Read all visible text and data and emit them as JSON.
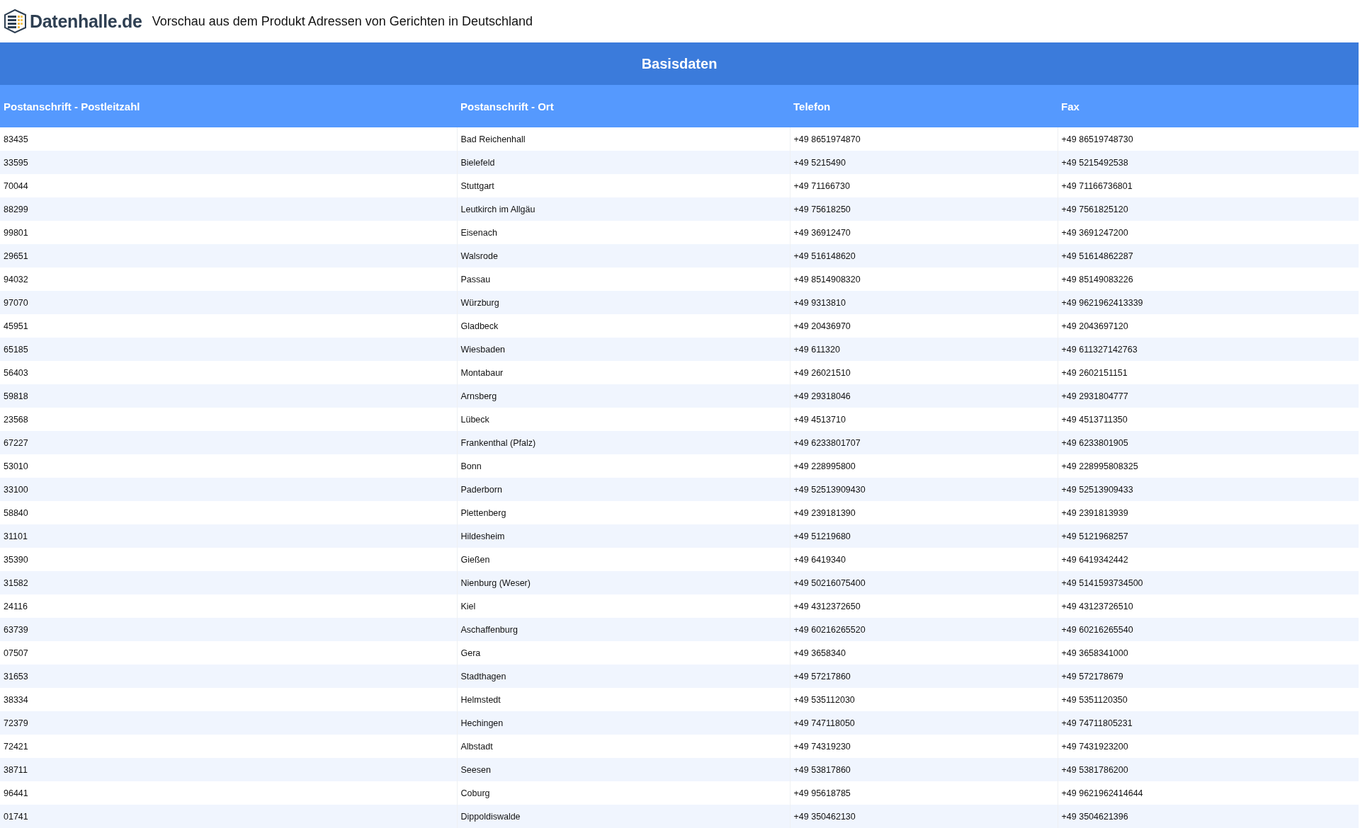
{
  "header": {
    "logo_text": "Datenhalle.de",
    "title": "Vorschau aus dem Produkt Adressen von Gerichten in Deutschland"
  },
  "table": {
    "group_title": "Basisdaten",
    "columns": [
      "Postanschrift - Postleitzahl",
      "Postanschrift - Ort",
      "Telefon",
      "Fax"
    ],
    "rows": [
      [
        "83435",
        "Bad Reichenhall",
        "+49 8651974870",
        "+49 86519748730"
      ],
      [
        "33595",
        "Bielefeld",
        "+49 5215490",
        "+49 5215492538"
      ],
      [
        "70044",
        "Stuttgart",
        "+49 71166730",
        "+49 71166736801"
      ],
      [
        "88299",
        "Leutkirch im Allgäu",
        "+49 75618250",
        "+49 7561825120"
      ],
      [
        "99801",
        "Eisenach",
        "+49 36912470",
        "+49 3691247200"
      ],
      [
        "29651",
        "Walsrode",
        "+49 516148620",
        "+49 51614862287"
      ],
      [
        "94032",
        "Passau",
        "+49 8514908320",
        "+49 85149083226"
      ],
      [
        "97070",
        "Würzburg",
        "+49 9313810",
        "+49 9621962413339"
      ],
      [
        "45951",
        "Gladbeck",
        "+49 20436970",
        "+49 2043697120"
      ],
      [
        "65185",
        "Wiesbaden",
        "+49 611320",
        "+49 611327142763"
      ],
      [
        "56403",
        "Montabaur",
        "+49 26021510",
        "+49 2602151151"
      ],
      [
        "59818",
        "Arnsberg",
        "+49 29318046",
        "+49 2931804777"
      ],
      [
        "23568",
        "Lübeck",
        "+49 4513710",
        "+49 4513711350"
      ],
      [
        "67227",
        "Frankenthal (Pfalz)",
        "+49 6233801707",
        "+49 6233801905"
      ],
      [
        "53010",
        "Bonn",
        "+49 228995800",
        "+49 228995808325"
      ],
      [
        "33100",
        "Paderborn",
        "+49 52513909430",
        "+49 52513909433"
      ],
      [
        "58840",
        "Plettenberg",
        "+49 239181390",
        "+49 2391813939"
      ],
      [
        "31101",
        "Hildesheim",
        "+49 51219680",
        "+49 5121968257"
      ],
      [
        "35390",
        "Gießen",
        "+49 6419340",
        "+49 6419342442"
      ],
      [
        "31582",
        "Nienburg (Weser)",
        "+49 50216075400",
        "+49 5141593734500"
      ],
      [
        "24116",
        "Kiel",
        "+49 4312372650",
        "+49 43123726510"
      ],
      [
        "63739",
        "Aschaffenburg",
        "+49 60216265520",
        "+49 60216265540"
      ],
      [
        "07507",
        "Gera",
        "+49 3658340",
        "+49 3658341000"
      ],
      [
        "31653",
        "Stadthagen",
        "+49 57217860",
        "+49 572178679"
      ],
      [
        "38334",
        "Helmstedt",
        "+49 535112030",
        "+49 5351120350"
      ],
      [
        "72379",
        "Hechingen",
        "+49 747118050",
        "+49 74711805231"
      ],
      [
        "72421",
        "Albstadt",
        "+49 74319230",
        "+49 7431923200"
      ],
      [
        "38711",
        "Seesen",
        "+49 53817860",
        "+49 5381786200"
      ],
      [
        "96441",
        "Coburg",
        "+49 95618785",
        "+49 9621962414644"
      ],
      [
        "01741",
        "Dippoldiswalde",
        "+49 350462130",
        "+49 3504621396"
      ]
    ]
  }
}
